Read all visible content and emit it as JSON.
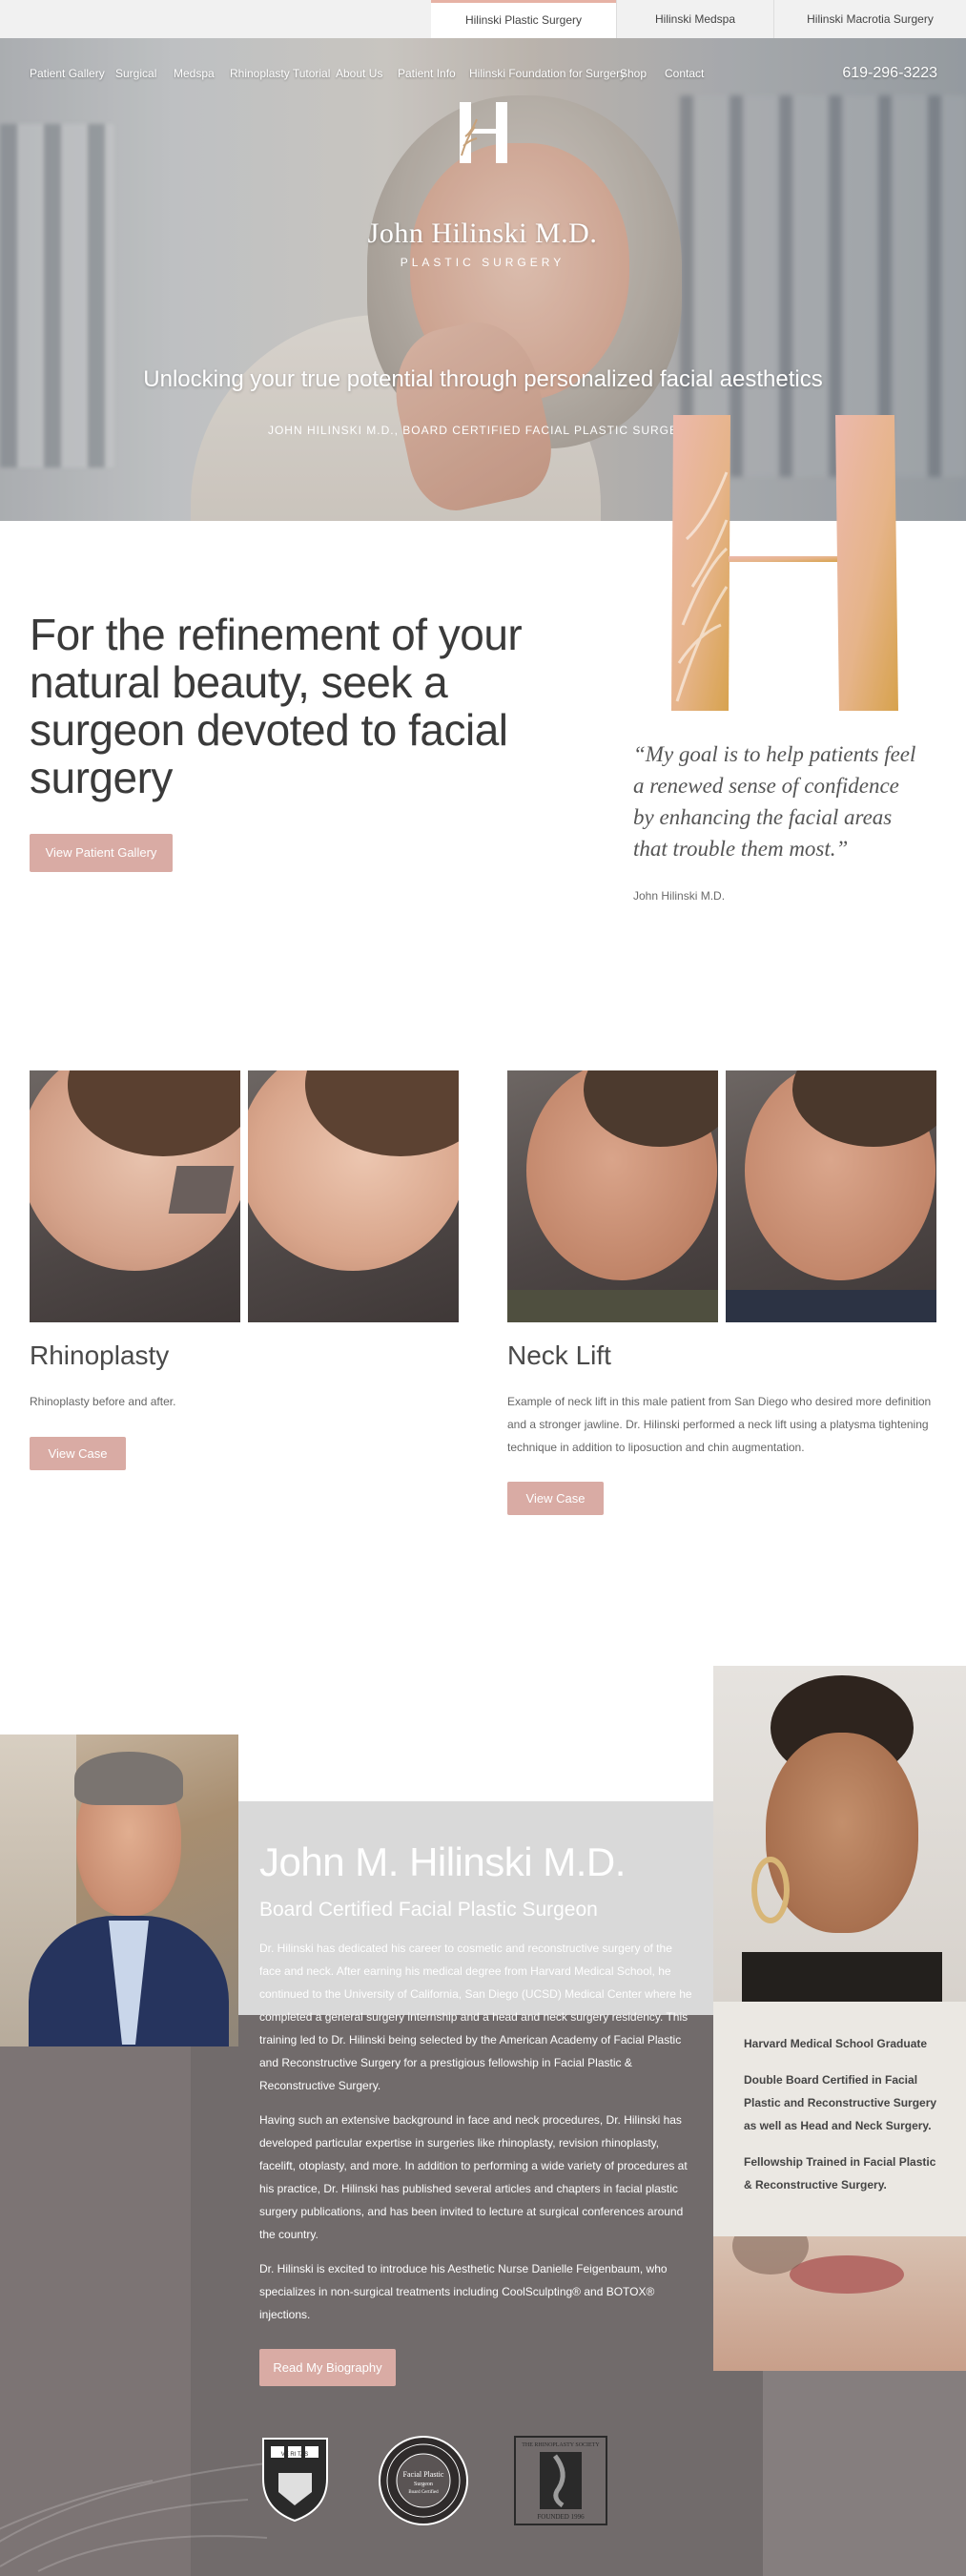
{
  "site_tabs": {
    "plastic_surgery": "Hilinski Plastic Surgery",
    "medspa": "Hilinski Medspa",
    "macrotia": "Hilinski Macrotia Surgery"
  },
  "nav": {
    "items": [
      "Patient Gallery",
      "Surgical",
      "Medspa",
      "Rhinoplasty Tutorial",
      "About Us",
      "Patient Info",
      "Hilinski Foundation for Surgery",
      "Shop",
      "Contact"
    ],
    "phone": "619-296-3223"
  },
  "hero": {
    "logo_name": "John Hilinski M.D.",
    "logo_sub": "PLASTIC SURGERY",
    "tagline": "Unlocking your true potential through personalized facial aesthetics",
    "credit": "JOHN HILINSKI M.D., BOARD CERTIFIED FACIAL PLASTIC SURGEON"
  },
  "intro": {
    "heading": "For the refinement of your natural beauty, seek a surgeon devoted to facial surgery",
    "button": "View Patient Gallery",
    "quote": "“My goal is to help patients feel a renewed sense of confidence by enhancing the facial areas that trouble them most.”",
    "quote_author": "John Hilinski M.D."
  },
  "cases": [
    {
      "title": "Rhinoplasty",
      "description": "Rhinoplasty before and after.",
      "button": "View Case"
    },
    {
      "title": "Neck Lift",
      "description": "Example of neck lift in this male patient from San Diego who desired more definition and a stronger jawline. Dr. Hilinski performed a neck lift using a platysma tightening technique in addition to liposuction and chin augmentation.",
      "button": "View Case"
    }
  ],
  "bio": {
    "name": "John M. Hilinski M.D.",
    "title": "Board Certified Facial Plastic Surgeon",
    "paragraphs": [
      "Dr. Hilinski has dedicated his career to cosmetic and reconstructive surgery of the face and neck. After earning his medical degree from Harvard Medical School, he continued to the University of California, San Diego (UCSD) Medical Center where he completed a general surgery internship and a head and neck surgery residency. This training led to Dr. Hilinski being selected by the American Academy of Facial Plastic and Reconstructive Surgery for a prestigious fellowship in Facial Plastic & Reconstructive Surgery.",
      "Having such an extensive background in face and neck procedures, Dr. Hilinski has developed particular expertise in surgeries like rhinoplasty, revision rhinoplasty, facelift, otoplasty, and more. In addition to performing a wide variety of procedures at his practice, Dr. Hilinski has published several articles and chapters in facial plastic surgery publications, and has been invited to lecture at surgical conferences around the country.",
      "Dr. Hilinski is excited to introduce his Aesthetic Nurse Danielle Feigenbaum, who specializes in non-surgical treatments including CoolSculpting® and BOTOX® injections."
    ],
    "button": "Read My Biography",
    "credentials": [
      "Harvard Medical School Graduate",
      "Double Board Certified in Facial Plastic and Reconstructive Surgery as well as Head and Neck Surgery.",
      "Fellowship Trained in Facial Plastic & Reconstructive Surgery."
    ]
  },
  "badges": {
    "harvard": "VE RI TAS",
    "board_line1": "Facial Plastic",
    "board_line2": "Surgeon",
    "board_line3": "Board Certified",
    "rhino_society": "THE RHINOPLASTY SOCIETY",
    "rhino_founded": "FOUNDED 1996"
  },
  "colors": {
    "accent_pink": "#d9aba4",
    "gold_start": "#e8b8a8",
    "gold_end": "#d8a24e",
    "bio_dark": "#7c7474"
  }
}
